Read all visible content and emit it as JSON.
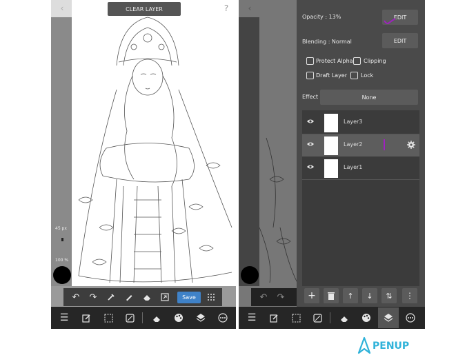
{
  "left_panel": {
    "top_button": "CLEAR LAYER",
    "brush_size": "45 px",
    "opacity": "100 %",
    "save_label": "Save"
  },
  "right_panel": {
    "opacity_label": "Opacity : 13%",
    "opacity_edit": "EDIT",
    "blending_label": "Blending : Normal",
    "blending_edit": "EDIT",
    "options": {
      "protect_alpha": "Protect Alpha",
      "clipping": "Clipping",
      "draft_layer": "Draft Layer",
      "lock": "Lock"
    },
    "effect_label": "Effect",
    "effect_value": "None",
    "layers": [
      {
        "name": "Layer3"
      },
      {
        "name": "Layer2"
      },
      {
        "name": "Layer1"
      }
    ]
  },
  "brand": {
    "name": "PENUP",
    "color": "#2fb2d9"
  }
}
